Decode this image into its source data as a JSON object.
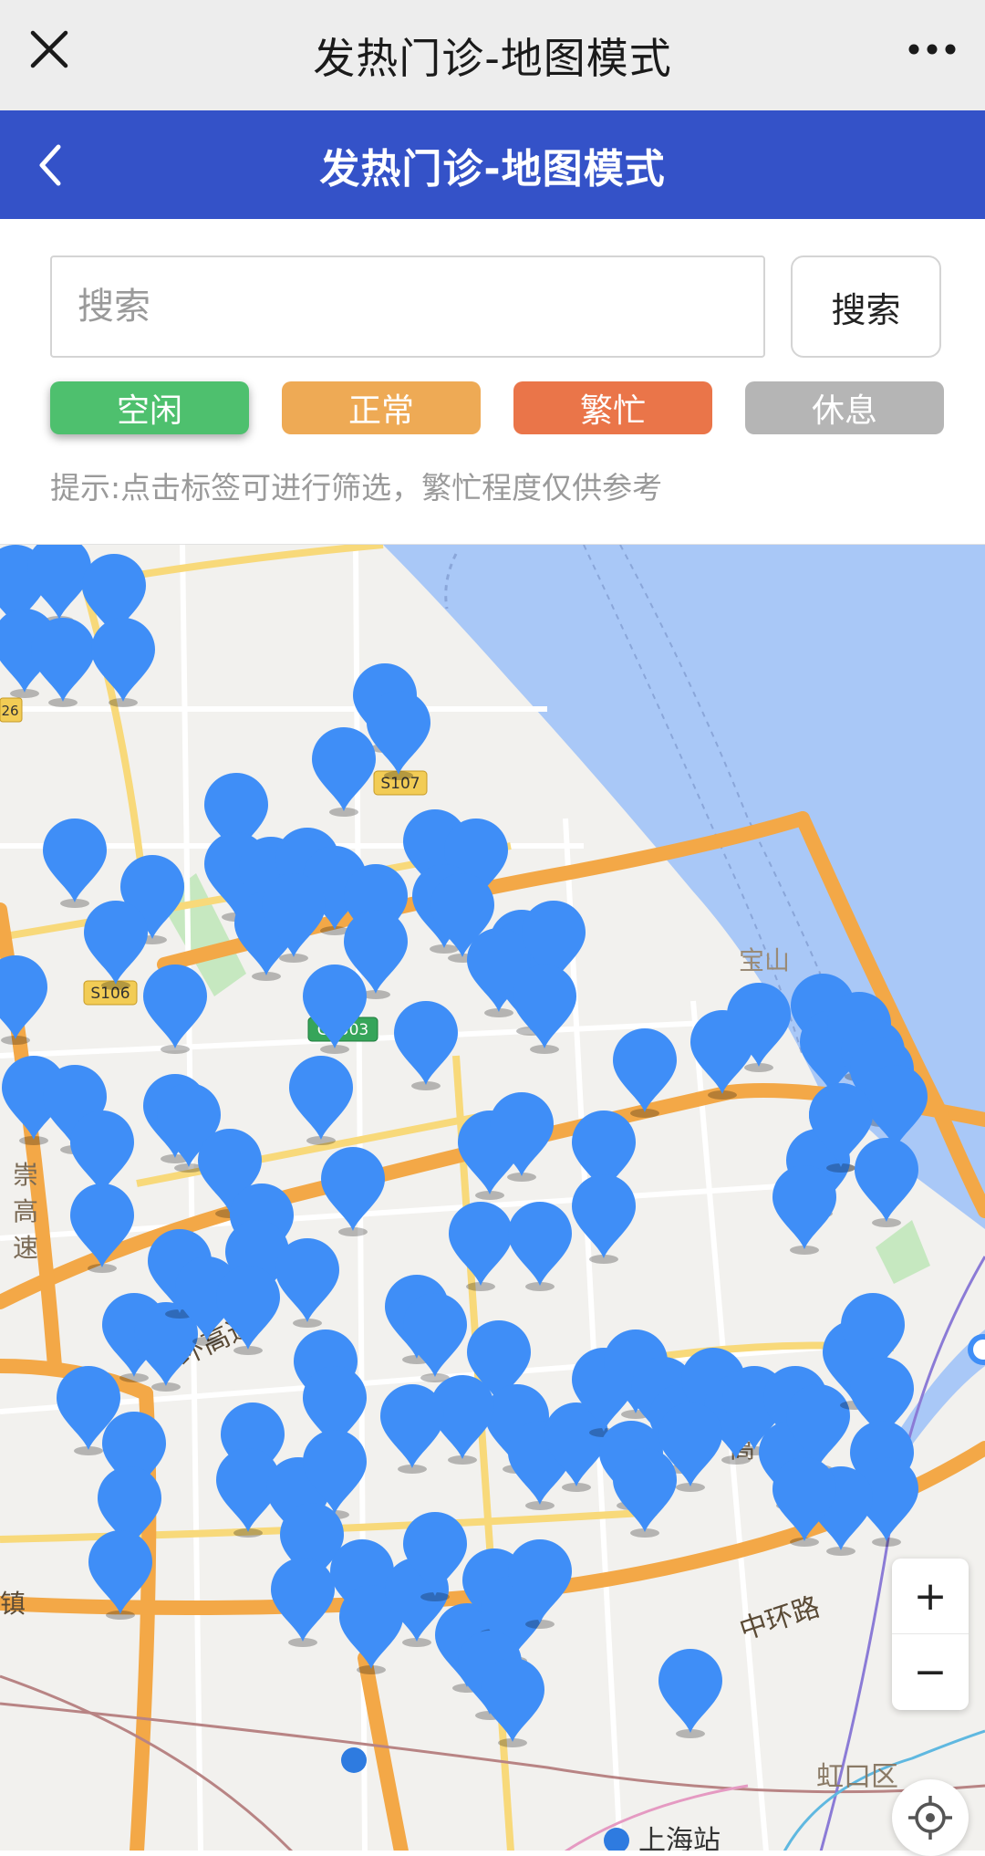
{
  "window": {
    "title": "发热门诊-地图模式"
  },
  "header": {
    "title": "发热门诊-地图模式"
  },
  "search": {
    "placeholder": "搜索",
    "button_label": "搜索"
  },
  "filters": [
    {
      "label": "空闲",
      "color": "#4ec06e"
    },
    {
      "label": "正常",
      "color": "#eeaa55"
    },
    {
      "label": "繁忙",
      "color": "#ea7549"
    },
    {
      "label": "休息",
      "color": "#b5b5b5"
    }
  ],
  "hint": "提示:点击标签可进行筛选，繁忙程度仅供参考",
  "map": {
    "labels": [
      "S107",
      "S106",
      "G1503",
      "26",
      "宝山",
      "崇",
      "高",
      "速",
      "中环路",
      "环高速",
      "镇",
      "上海站",
      "虹口区",
      "高"
    ],
    "pin_color": "#3f8ef7",
    "zoom_in": "+",
    "zoom_out": "−"
  }
}
